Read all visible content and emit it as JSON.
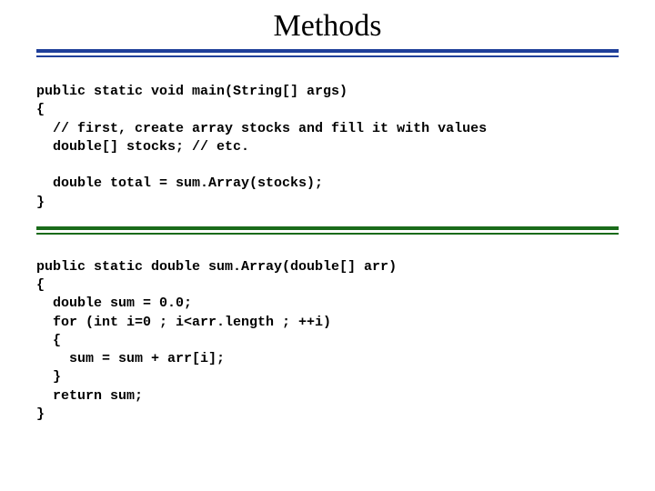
{
  "title": "Methods",
  "code_block_1": "public static void main(String[] args)\n{\n  // first, create array stocks and fill it with values\n  double[] stocks; // etc.\n\n  double total = sum.Array(stocks);\n}",
  "code_block_2": "public static double sum.Array(double[] arr)\n{\n  double sum = 0.0;\n  for (int i=0 ; i<arr.length ; ++i)\n  {\n    sum = sum + arr[i];\n  }\n  return sum;\n}"
}
